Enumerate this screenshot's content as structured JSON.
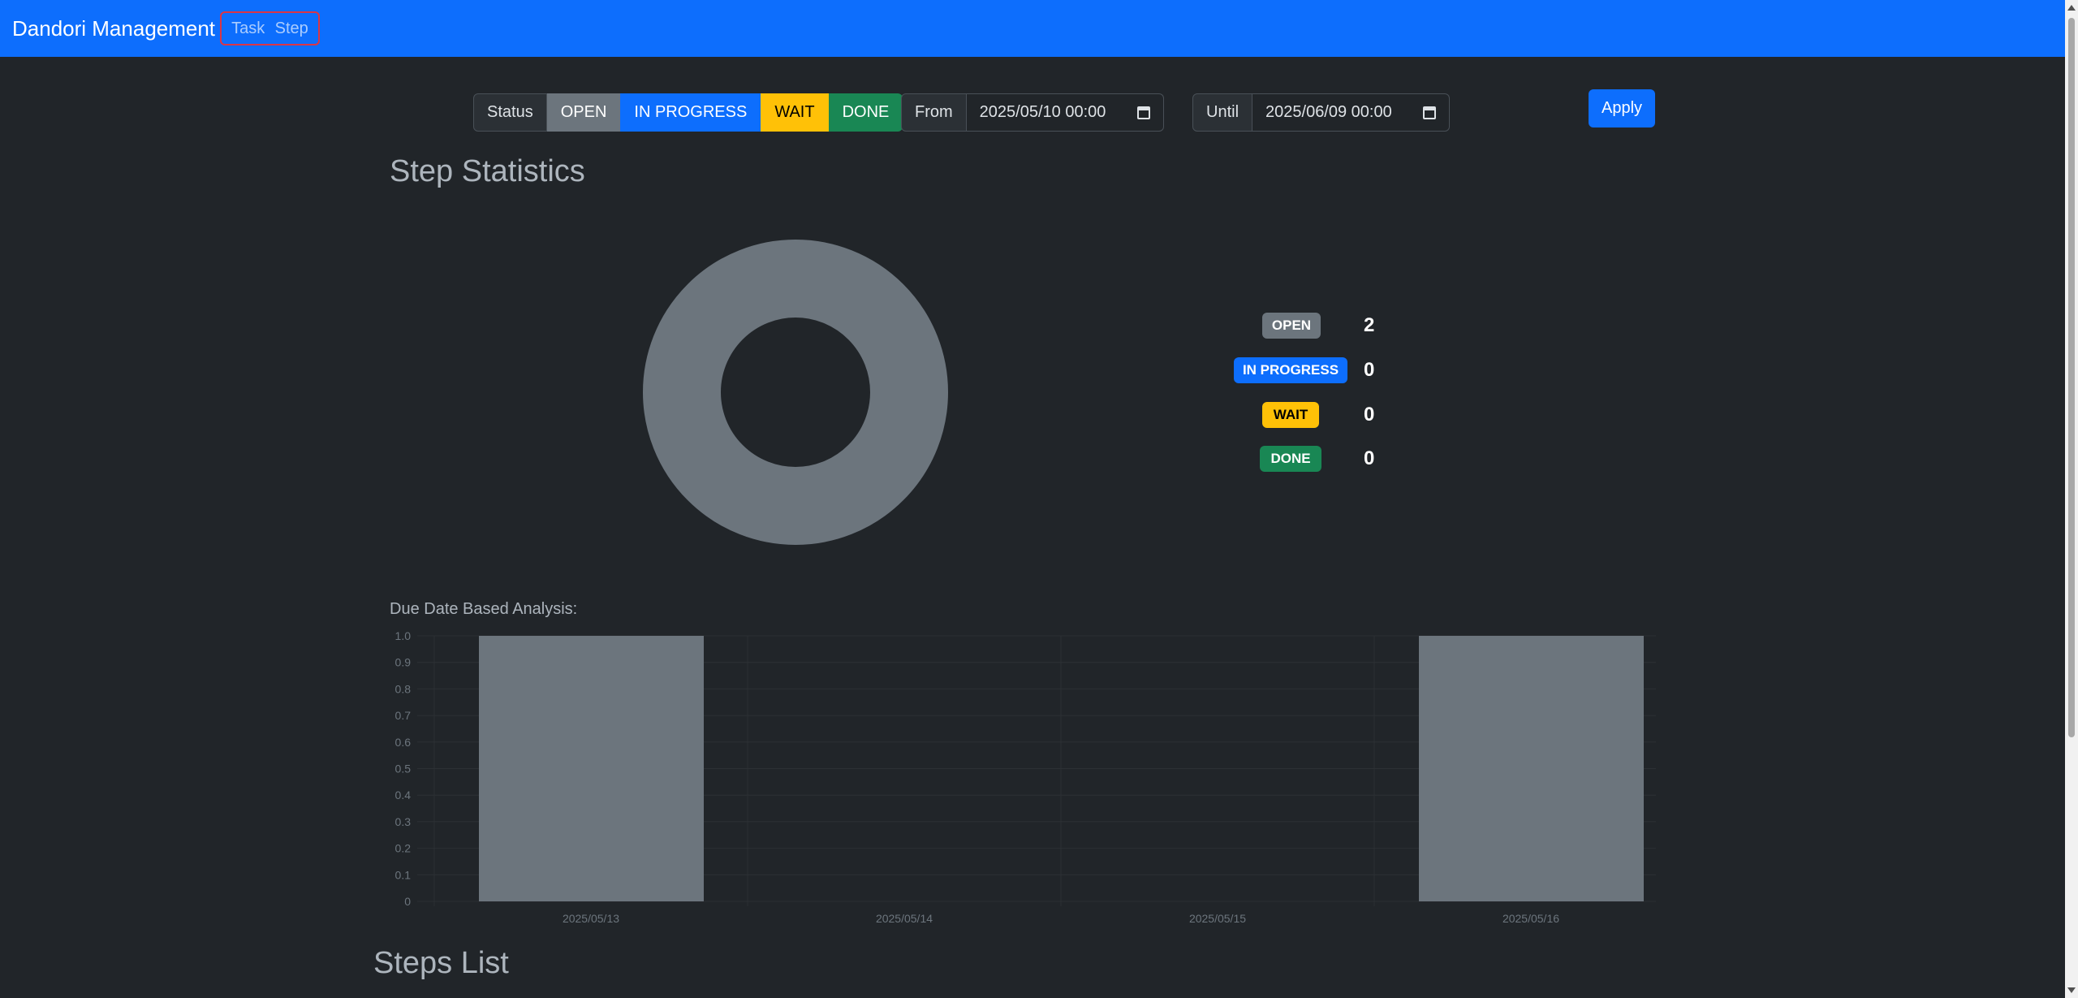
{
  "navbar": {
    "brand": "Dandori Management",
    "links": [
      "Task",
      "Step"
    ]
  },
  "filters": {
    "status_label": "Status",
    "statuses": [
      "OPEN",
      "IN PROGRESS",
      "WAIT",
      "DONE"
    ],
    "from_label": "From",
    "from_value": "2025/05/10 00:00",
    "until_label": "Until",
    "until_value": "2025/06/09 00:00",
    "apply_label": "Apply"
  },
  "stats": {
    "title": "Step Statistics",
    "legend": [
      {
        "label": "OPEN",
        "count": "2"
      },
      {
        "label": "IN PROGRESS",
        "count": "0"
      },
      {
        "label": "WAIT",
        "count": "0"
      },
      {
        "label": "DONE",
        "count": "0"
      }
    ]
  },
  "colors": {
    "open": "#6c757d",
    "in_progress": "#0d6efd",
    "wait": "#ffc107",
    "done": "#198754"
  },
  "analysis": {
    "label": "Due Date Based Analysis:"
  },
  "chart_data": [
    {
      "type": "pie",
      "categories": [
        "OPEN",
        "IN PROGRESS",
        "WAIT",
        "DONE"
      ],
      "values": [
        2,
        0,
        0,
        0
      ]
    },
    {
      "type": "bar",
      "categories": [
        "2025/05/13",
        "2025/05/14",
        "2025/05/15",
        "2025/05/16"
      ],
      "values": [
        1,
        0,
        0,
        1
      ],
      "ylim": [
        0,
        1.0
      ],
      "yticks": [
        "0",
        "0.1",
        "0.2",
        "0.3",
        "0.4",
        "0.5",
        "0.6",
        "0.7",
        "0.8",
        "0.9",
        "1.0"
      ],
      "grid": true
    }
  ],
  "list": {
    "title": "Steps List"
  }
}
